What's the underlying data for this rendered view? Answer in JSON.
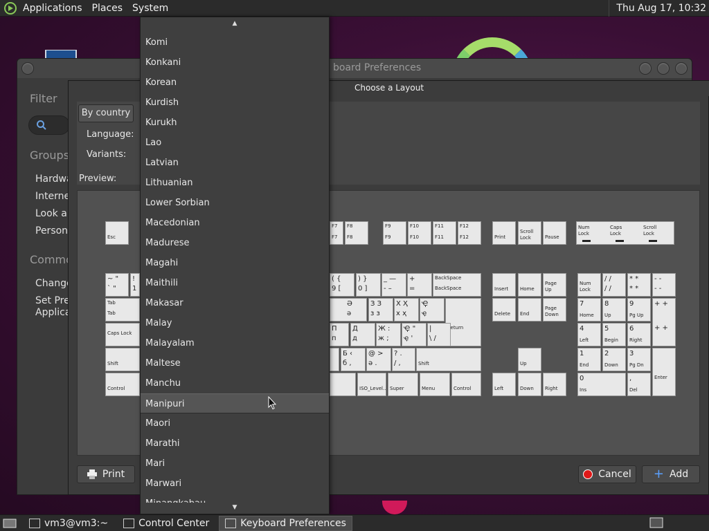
{
  "top_panel": {
    "menus": [
      "Applications",
      "Places",
      "System"
    ],
    "clock": "Thu Aug 17, 10:32"
  },
  "control_center": {
    "filter_heading": "Filter",
    "groups_heading": "Groups",
    "group_items": [
      "Hardwa",
      "Internet",
      "Look an",
      "Persona"
    ],
    "common_heading": "Commo",
    "common_items": [
      "Change",
      "Set Pref",
      "Applicat"
    ]
  },
  "keyboard_prefs": {
    "title": "board Preferences"
  },
  "choose_layout": {
    "title": "Choose a Layout",
    "tab_by_country": "By country",
    "language_label": "Language:",
    "variants_label": "Variants:",
    "preview_label": "Preview:",
    "print_button": "Print",
    "cancel_button": "Cancel",
    "add_button": "Add"
  },
  "dropdown": {
    "items": [
      "Komi",
      "Konkani",
      "Korean",
      "Kurdish",
      "Kurukh",
      "Lao",
      "Latvian",
      "Lithuanian",
      "Lower Sorbian",
      "Macedonian",
      "Madurese",
      "Magahi",
      "Maithili",
      "Makasar",
      "Malay",
      "Malayalam",
      "Maltese",
      "Manchu",
      "Manipuri",
      "Maori",
      "Marathi",
      "Mari",
      "Marwari",
      "Minangkabau"
    ],
    "selected": "Manipuri"
  },
  "keys": {
    "esc": "Esc",
    "f7": "F7",
    "f8": "F8",
    "f9": "F9",
    "f10": "F10",
    "f11": "F11",
    "f12": "F12",
    "print": "Print",
    "scroll_lock": "Scroll Lock",
    "pause": "Pause",
    "num_lock": "Num Lock",
    "caps_lock_ind": "Caps Lock",
    "scroll_lock_ind": "Scroll Lock",
    "tilde": "~  \"",
    "tilde2": "`  \"",
    "excl": "!",
    "one": "1",
    "paren_l": "(   {",
    "nine": "9   [",
    "paren_r": ")   }",
    "zero": "0   ]",
    "minus": "_  —",
    "minus2": "-   –",
    "plus": "+",
    "eq": "=",
    "backspace": "BackSpace",
    "backspace2": "BackSpace",
    "insert": "Insert",
    "home": "Home",
    "page_up": "Page Up",
    "num_lock2": "Num Lock",
    "slash": "/   /",
    "slash2": "/   /",
    "star": "*   *",
    "star2": "*   *",
    "dash": "-   -",
    "dash2": "-   -",
    "tab": "Tab",
    "tab2": "Tab",
    "e_schwa": "Ә",
    "e_schwa2": "ә",
    "ze": "З  З",
    "ze2": "з  з",
    "ha": "Х  Ҳ",
    "ha2": "х  ҳ",
    "che": "Ҿ",
    "che2": "ҿ",
    "delete": "Delete",
    "end": "End",
    "page_down": "Page Down",
    "n7": "7",
    "home2": "Home",
    "n8": "8",
    "up": "Up",
    "n9": "9",
    "pgup": "Pg Up",
    "plus_k": "+   +",
    "caps": "Caps Lock",
    "pe": "П",
    "pe2": "п",
    "de": "Д",
    "de2": "д",
    "zhe": "Ж  :",
    "zhe2": "ж  ;",
    "quote": "Ҿ  \"",
    "quote2": "ҿ  '",
    "pipe": "|",
    "pipe2": "\\   /",
    "return": "Return",
    "n4": "4",
    "left": "Left",
    "n5": "5",
    "begin": "Begin",
    "n6": "6",
    "right": "Right",
    "plus_k2": "+   +",
    "shift": "Shift",
    "be": "Б  ‹",
    "be2": "б  ,",
    "at": "@  >",
    "at2": "ә  .",
    "q": "?   .",
    "q2": "/   ,",
    "shift_r": "Shift",
    "up_arrow": "Up",
    "n1": "1",
    "end2": "End",
    "n2": "2",
    "down": "Down",
    "n3": "3",
    "pgdn": "Pg Dn",
    "control": "Control",
    "iso_level": "ISO_Level...",
    "super": "Super",
    "menu": "Menu",
    "control_r": "Control",
    "left_arrow": "Left",
    "down_arrow": "Down",
    "right_arrow": "Right",
    "n0": "0",
    "ins": "Ins",
    "comma": ",",
    "del": "Del",
    "enter": "Enter"
  },
  "taskbar": {
    "items": [
      "vm3@vm3:~",
      "Control Center",
      "Keyboard Preferences"
    ]
  }
}
